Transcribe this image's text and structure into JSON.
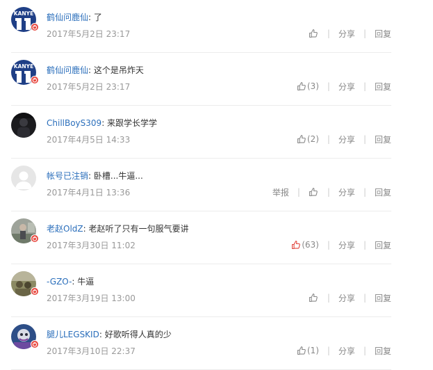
{
  "labels": {
    "share": "分享",
    "reply": "回复",
    "report": "举报"
  },
  "comments": [
    {
      "username": "鹤仙问鹿仙",
      "text": ": 了",
      "time": "2017年5月2日 23:17",
      "likes": "",
      "liked": false,
      "report": false,
      "avatar": "kanye",
      "badge": true
    },
    {
      "username": "鹤仙问鹿仙",
      "text": ": 这个是吊炸天",
      "time": "2017年5月2日 23:17",
      "likes": "(3)",
      "liked": false,
      "report": false,
      "avatar": "kanye",
      "badge": true
    },
    {
      "username": "ChillBoyS309",
      "text": ": 来跟学长学学",
      "time": "2017年4月5日 14:33",
      "likes": "(2)",
      "liked": false,
      "report": false,
      "avatar": "dark",
      "badge": false
    },
    {
      "username": "帐号已注销",
      "text": ": 卧槽...牛逼...",
      "time": "2017年4月1日 13:36",
      "likes": "",
      "liked": false,
      "report": true,
      "avatar": "default",
      "badge": false
    },
    {
      "username": "老赵OldZ",
      "text": ": 老赵听了只有一句服气要讲",
      "time": "2017年3月30日 11:02",
      "likes": "(63)",
      "liked": true,
      "report": false,
      "avatar": "photo-grey",
      "badge": true
    },
    {
      "username": "-GZO-",
      "text": ": 牛逼",
      "time": "2017年3月19日 13:00",
      "likes": "",
      "liked": false,
      "report": false,
      "avatar": "photo-olive",
      "badge": true
    },
    {
      "username": "腿儿LEGSKID",
      "text": ": 好歌听得人真的少",
      "time": "2017年3月10日 22:37",
      "likes": "(1)",
      "liked": false,
      "report": false,
      "avatar": "photo-blue",
      "badge": true
    }
  ]
}
